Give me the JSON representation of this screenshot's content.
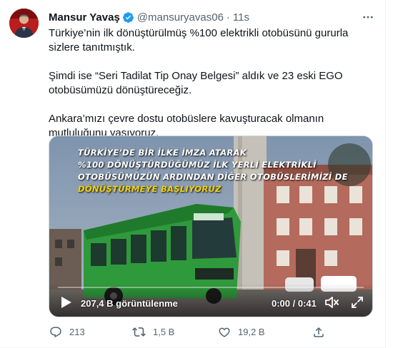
{
  "tweet": {
    "author_name": "Mansur Yavaş",
    "handle": "@mansuryavas06",
    "separator": "·",
    "time": "11s",
    "paragraphs": [
      "Türkiye’nin ilk dönüştürülmüş %100 elektrikli otobüsünü gururla sizlere tanıtmıştık.",
      "Şimdi ise “Seri Tadilat Tip Onay Belgesi” aldık ve 23 eski EGO otobüsümüzü dönüştüreceğiz.",
      "Ankara’mızı çevre dostu otobüslere kavuşturacak olmanın mutluluğunu yaşıyoruz."
    ]
  },
  "video": {
    "caption_lines": [
      "TÜRKİYE’DE BİR İLKE İMZA ATARAK",
      "%100 DÖNÜŞTÜRDÜĞÜMÜZ İLK YERLİ ELEKTRİKLİ",
      "OTOBÜSÜMÜZÜN ARDINDAN DİĞER OTOBÜSLERİMİZİ DE",
      "DÖNÜŞTÜRMEYE BAŞLIYORUZ"
    ],
    "views": "207,4 B görüntülenme",
    "duration": "0:00 / 0:41",
    "progress": 0.0,
    "accent_color": "#1d9bf0"
  },
  "actions": {
    "replies": "213",
    "retweets": "1,5 B",
    "likes": "19,2 B"
  },
  "icons": {
    "verified": "verified-badge-icon",
    "more": "more-options-icon",
    "reply": "reply-icon",
    "retweet": "retweet-icon",
    "like": "heart-icon",
    "share": "share-icon",
    "play": "play-icon",
    "mute": "volume-icon",
    "fullscreen": "fullscreen-icon"
  },
  "colors": {
    "text": "#0f1419",
    "muted": "#536471",
    "verified": "#1d9bf0",
    "caption_highlight": "#f4d20c"
  }
}
